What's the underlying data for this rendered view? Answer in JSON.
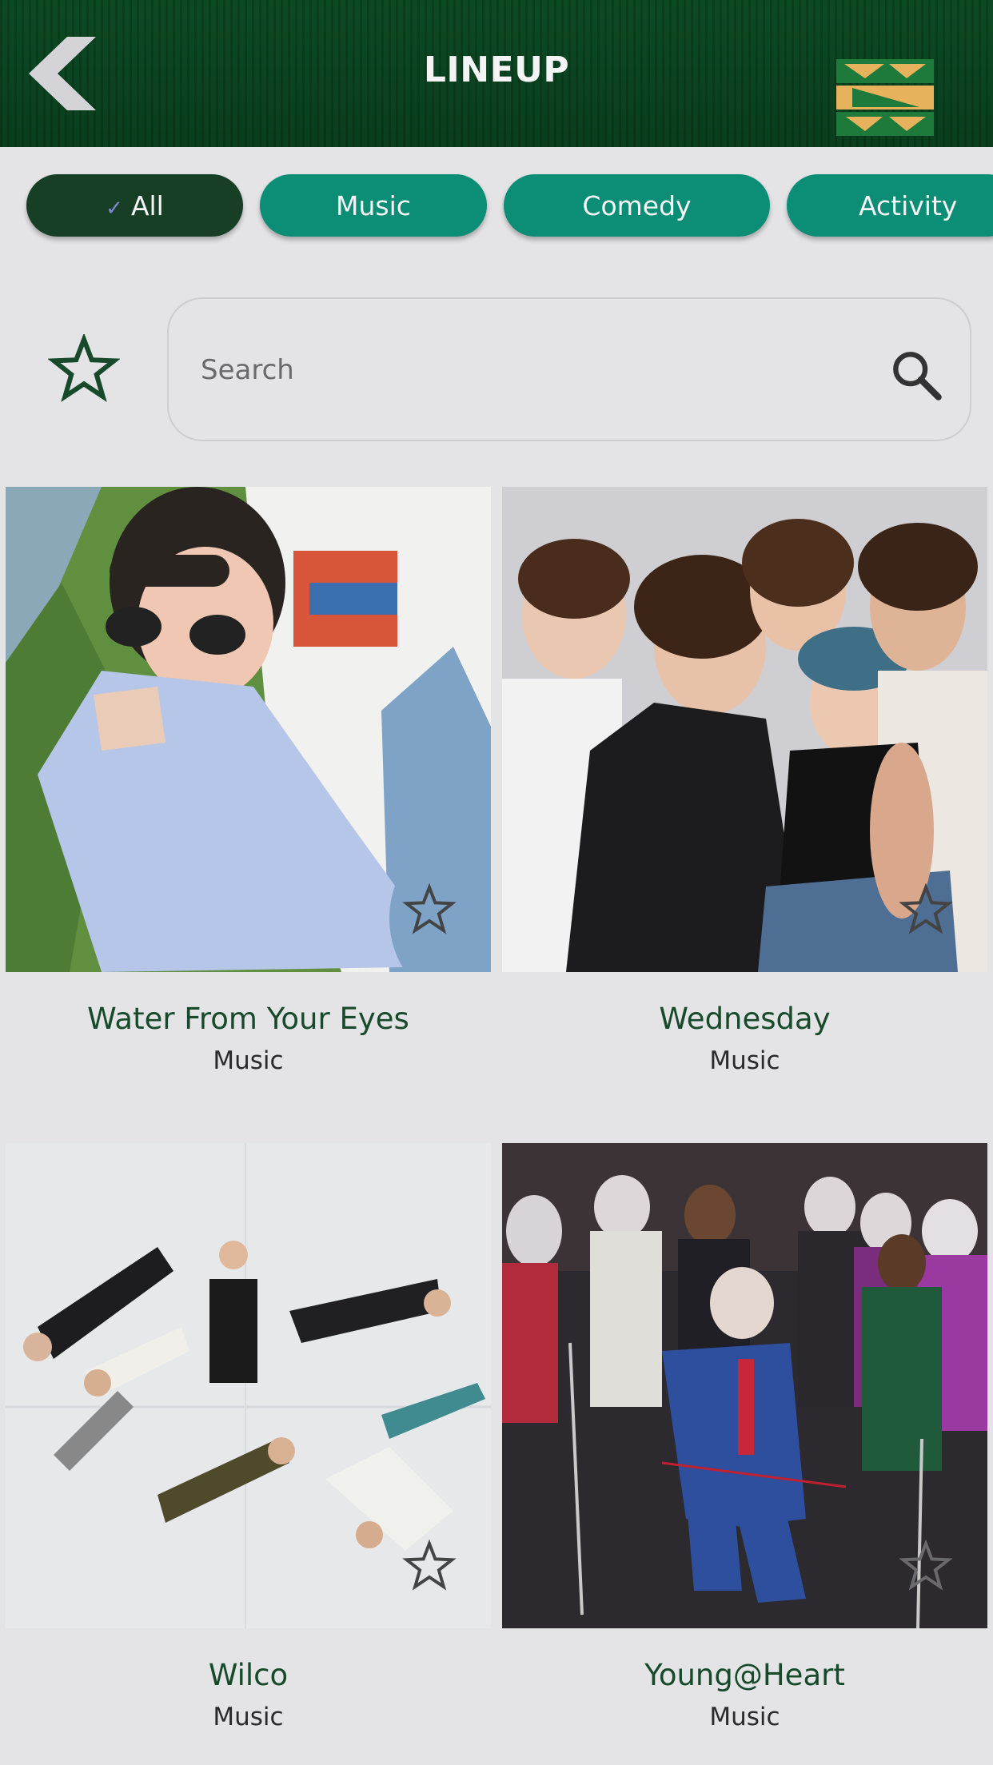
{
  "header": {
    "title": "LINEUP",
    "back_icon": "chevron-left-icon",
    "logo_icon": "festival-logo-icon",
    "colors": {
      "bar": "#0c4a24",
      "logo_green": "#1d7a3a",
      "logo_gold": "#e6b25c"
    }
  },
  "filters": [
    {
      "label": "All",
      "active": true,
      "check_icon": "check-icon"
    },
    {
      "label": "Music",
      "active": false
    },
    {
      "label": "Comedy",
      "active": false
    },
    {
      "label": "Activity",
      "active": false
    }
  ],
  "filter_colors": {
    "active": "#173f25",
    "inactive": "#0c8e76"
  },
  "search": {
    "placeholder": "Search",
    "value": "",
    "icon": "search-icon"
  },
  "favorites_toggle_icon": "star-outline-icon",
  "artists": [
    {
      "name": "Water From Your Eyes",
      "category": "Music",
      "favorite": false
    },
    {
      "name": "Wednesday",
      "category": "Music",
      "favorite": false
    },
    {
      "name": "Wilco",
      "category": "Music",
      "favorite": false
    },
    {
      "name": "Young@Heart",
      "category": "Music",
      "favorite": false
    }
  ]
}
